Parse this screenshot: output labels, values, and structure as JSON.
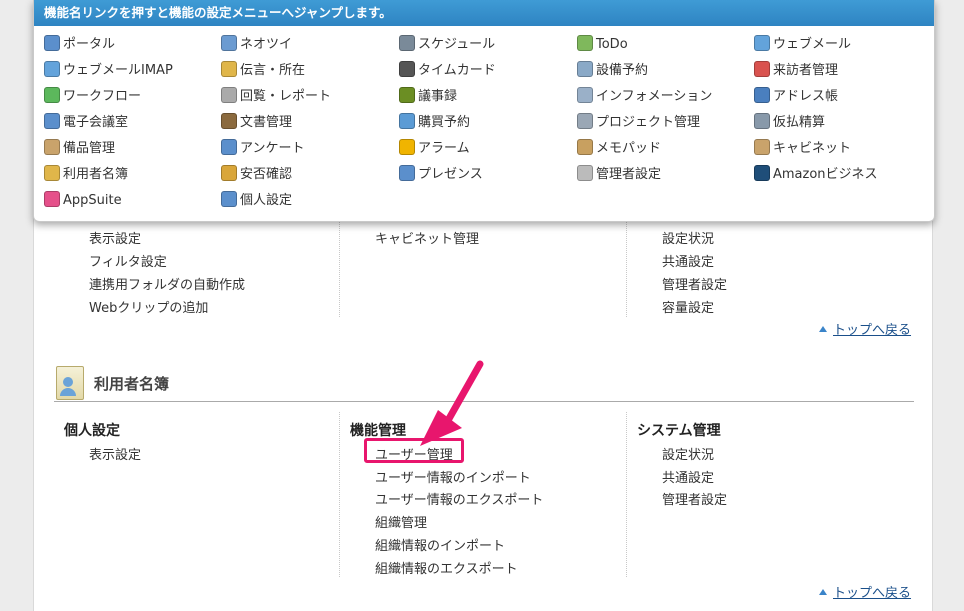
{
  "menu": {
    "header": "機能名リンクを押すと機能の設定メニューへジャンプします。",
    "items": [
      {
        "label": "ポータル",
        "icon": "portal-icon",
        "color": "#5b8fcc"
      },
      {
        "label": "ネオツイ",
        "icon": "neotwi-icon",
        "color": "#6b9bd1"
      },
      {
        "label": "スケジュール",
        "icon": "schedule-icon",
        "color": "#7a8a99"
      },
      {
        "label": "ToDo",
        "icon": "todo-icon",
        "color": "#7fb85c"
      },
      {
        "label": "ウェブメール",
        "icon": "webmail-icon",
        "color": "#63a3db"
      },
      {
        "label": "ウェブメールIMAP",
        "icon": "webmail-imap-icon",
        "color": "#63a3db"
      },
      {
        "label": "伝言・所在",
        "icon": "message-icon",
        "color": "#e0b64a"
      },
      {
        "label": "タイムカード",
        "icon": "timecard-icon",
        "color": "#555555"
      },
      {
        "label": "設備予約",
        "icon": "facility-icon",
        "color": "#8aa9c7"
      },
      {
        "label": "来訪者管理",
        "icon": "visitor-icon",
        "color": "#d9534f"
      },
      {
        "label": "ワークフロー",
        "icon": "workflow-icon",
        "color": "#5cb85c"
      },
      {
        "label": "回覧・レポート",
        "icon": "circular-icon",
        "color": "#aaaaaa"
      },
      {
        "label": "議事録",
        "icon": "minutes-icon",
        "color": "#6b8e23"
      },
      {
        "label": "インフォメーション",
        "icon": "information-icon",
        "color": "#9ab0c8"
      },
      {
        "label": "アドレス帳",
        "icon": "address-book-icon",
        "color": "#4a7fbf"
      },
      {
        "label": "電子会議室",
        "icon": "forum-icon",
        "color": "#5b8fcc"
      },
      {
        "label": "文書管理",
        "icon": "document-icon",
        "color": "#8b6a3e"
      },
      {
        "label": "購買予約",
        "icon": "purchase-icon",
        "color": "#5b9bd5"
      },
      {
        "label": "プロジェクト管理",
        "icon": "project-icon",
        "color": "#9aa7b5"
      },
      {
        "label": "仮払精算",
        "icon": "expense-icon",
        "color": "#8899aa"
      },
      {
        "label": "備品管理",
        "icon": "equipment-icon",
        "color": "#c9a36b"
      },
      {
        "label": "アンケート",
        "icon": "survey-icon",
        "color": "#5b8fcc"
      },
      {
        "label": "アラーム",
        "icon": "alarm-icon",
        "color": "#f0b400"
      },
      {
        "label": "メモパッド",
        "icon": "memopad-icon",
        "color": "#c8a060"
      },
      {
        "label": "キャビネット",
        "icon": "cabinet-icon",
        "color": "#c9a36b"
      },
      {
        "label": "利用者名簿",
        "icon": "user-directory-icon",
        "color": "#e0b64a"
      },
      {
        "label": "安否確認",
        "icon": "safety-icon",
        "color": "#d9a63a"
      },
      {
        "label": "プレゼンス",
        "icon": "presence-icon",
        "color": "#5b8fcc"
      },
      {
        "label": "管理者設定",
        "icon": "admin-settings-icon",
        "color": "#bbbbbb"
      },
      {
        "label": "Amazonビジネス",
        "icon": "amazon-icon",
        "color": "#1f4e79"
      },
      {
        "label": "AppSuite",
        "icon": "appsuite-icon",
        "color": "#e5508a"
      },
      {
        "label": "個人設定",
        "icon": "personal-settings-icon",
        "color": "#5b8fcc"
      }
    ]
  },
  "section_prev": {
    "col1": [
      "表示設定",
      "フィルタ設定",
      "連携用フォルダの自動作成",
      "Webクリップの追加"
    ],
    "col2": [
      "キャビネット管理"
    ],
    "col3": [
      "設定状況",
      "共通設定",
      "管理者設定",
      "容量設定"
    ],
    "back_to_top": "トップへ戻る"
  },
  "section_users": {
    "title": "利用者名簿",
    "col1": {
      "heading": "個人設定",
      "items": [
        "表示設定"
      ]
    },
    "col2": {
      "heading": "機能管理",
      "items": [
        "ユーザー管理",
        "ユーザー情報のインポート",
        "ユーザー情報のエクスポート",
        "組織管理",
        "組織情報のインポート",
        "組織情報のエクスポート"
      ]
    },
    "col3": {
      "heading": "システム管理",
      "items": [
        "設定状況",
        "共通設定",
        "管理者設定"
      ]
    },
    "back_to_top": "トップへ戻る"
  },
  "annotation_color": "#e8166d"
}
